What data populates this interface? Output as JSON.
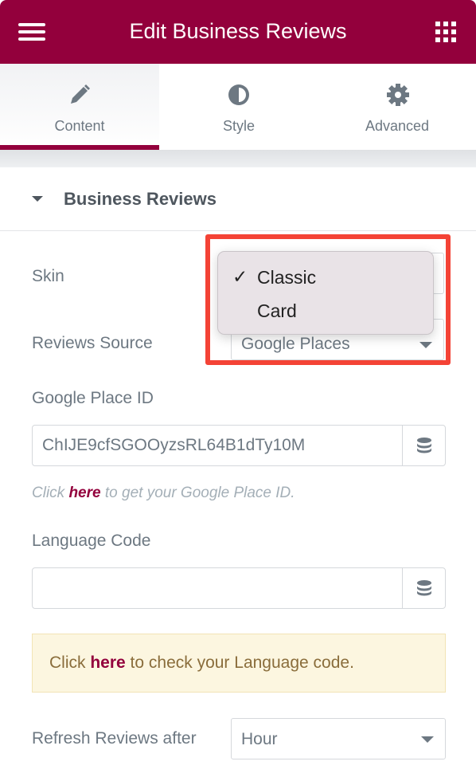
{
  "header": {
    "title": "Edit Business Reviews",
    "menu_icon": "hamburger-icon",
    "apps_icon": "grid-icon"
  },
  "tabs": [
    {
      "label": "Content",
      "icon": "pencil-icon",
      "active": true
    },
    {
      "label": "Style",
      "icon": "half-circle-icon"
    },
    {
      "label": "Advanced",
      "icon": "gear-icon"
    }
  ],
  "section": {
    "title": "Business Reviews"
  },
  "fields": {
    "skin": {
      "label": "Skin",
      "options": [
        "Classic",
        "Card"
      ],
      "selected": "Classic"
    },
    "reviews_source": {
      "label": "Reviews Source",
      "value": "Google Places"
    },
    "place_id": {
      "label": "Google Place ID",
      "value": "ChIJE9cfSGOOyzsRL64B1dTy10M"
    },
    "place_help": {
      "pre": "Click ",
      "link": "here",
      "post": " to get your Google Place ID."
    },
    "language": {
      "label": "Language Code",
      "value": ""
    },
    "language_alert": {
      "pre": "Click ",
      "link": "here",
      "post": " to check your Language code."
    },
    "refresh": {
      "label": "Refresh Reviews after",
      "value": "Hour"
    }
  },
  "colors": {
    "brand": "#93003c",
    "highlight": "#f44336"
  }
}
